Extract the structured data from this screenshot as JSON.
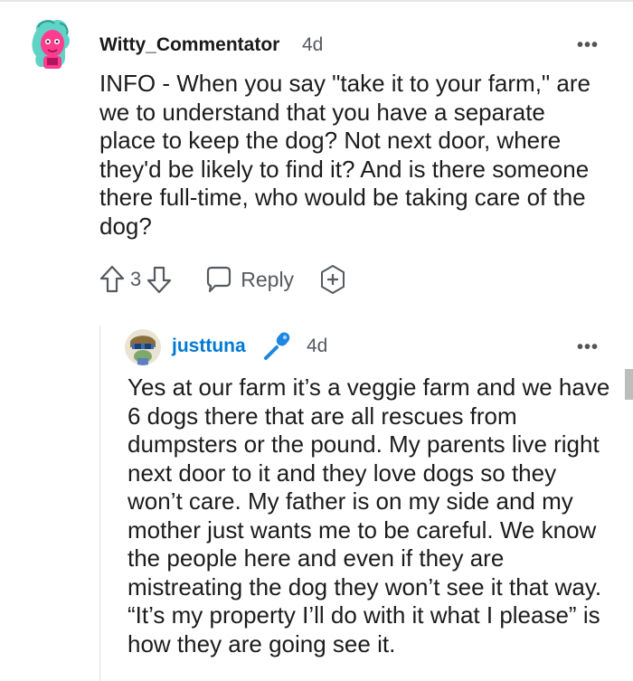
{
  "comment1": {
    "username": "Witty_Commentator",
    "age": "4d",
    "more": "•••",
    "body": "INFO - When you say \"take it to your farm,\" are we to understand that you have a separate place to keep the dog? Not next door, where they'd be likely to find it? And is there someone there full-time, who would be taking care of the dog?",
    "votes": "3",
    "reply_label": "Reply"
  },
  "comment2": {
    "username": "justtuna",
    "age": "4d",
    "more": "•••",
    "body": "Yes at our farm it’s a veggie farm and we have 6 dogs there that are all rescues from dumpsters or the pound. My parents live right next door to it and they love dogs so they won’t care. My father is on my side and my mother just wants me to be careful. We know the people here and even if they are mistreating the dog they won’t see it that way. “It’s my property I’ll do with it what I please” is how they are going see it.",
    "username_color": "#0079d3",
    "mic_color": "#0079d3"
  },
  "colors": {
    "upvote_icon": "#555a5f",
    "meta_text": "#555a5f"
  },
  "icons": [
    "upvote-icon",
    "downvote-icon",
    "comment-bubble-icon",
    "award-plus-icon",
    "microphone-icon",
    "more-options-icon"
  ]
}
